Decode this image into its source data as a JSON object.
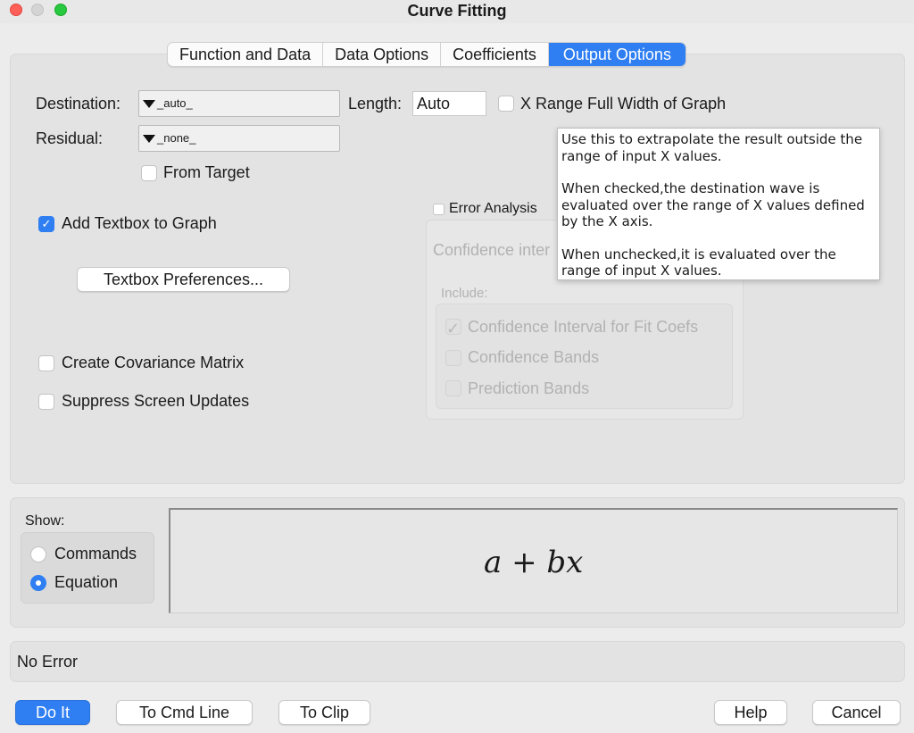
{
  "window": {
    "title": "Curve Fitting"
  },
  "tabs": [
    {
      "label": "Function and Data"
    },
    {
      "label": "Data Options"
    },
    {
      "label": "Coefficients"
    },
    {
      "label": "Output Options"
    }
  ],
  "active_tab": "Output Options",
  "destination": {
    "label": "Destination:",
    "value": "_auto_"
  },
  "length": {
    "label": "Length:",
    "value": "Auto"
  },
  "x_range": {
    "label": "X Range Full Width of Graph",
    "checked": false
  },
  "residual": {
    "label": "Residual:",
    "value": "_none_"
  },
  "from_target": {
    "label": "From Target",
    "checked": false
  },
  "add_textbox": {
    "label": "Add Textbox to Graph",
    "checked": true
  },
  "textbox_prefs": {
    "label": "Textbox Preferences..."
  },
  "covariance": {
    "label": "Create Covariance Matrix",
    "checked": false
  },
  "suppress": {
    "label": "Suppress Screen Updates",
    "checked": false
  },
  "error_analysis": {
    "label": "Error Analysis",
    "checked": false,
    "confidence_label": "Confidence inter",
    "include_label": "Include:",
    "options": [
      {
        "label": "Confidence Interval for Fit Coefs",
        "checked": true
      },
      {
        "label": "Confidence Bands",
        "checked": false
      },
      {
        "label": "Prediction Bands",
        "checked": false
      }
    ]
  },
  "tooltip": {
    "p1": "Use this to extrapolate the result outside the range of input X values.",
    "p2": "When checked,the destination wave is evaluated over the range of X values defined by the X axis.",
    "p3": "When unchecked,it is evaluated over the range of input X values."
  },
  "show": {
    "label": "Show:",
    "options": [
      {
        "label": "Commands",
        "selected": false
      },
      {
        "label": "Equation",
        "selected": true
      }
    ],
    "equation": "a + bx"
  },
  "status": "No Error",
  "buttons": {
    "do_it": "Do It",
    "to_cmd_line": "To Cmd Line",
    "to_clip": "To Clip",
    "help": "Help",
    "cancel": "Cancel"
  }
}
